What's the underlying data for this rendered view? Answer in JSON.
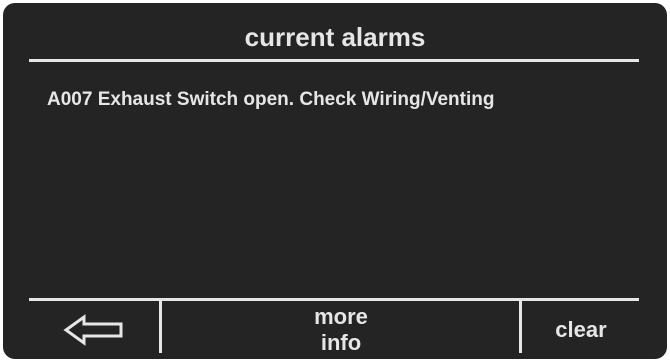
{
  "header": {
    "title": "current alarms"
  },
  "alarms": [
    {
      "text": "A007 Exhaust Switch open. Check Wiring/Venting"
    }
  ],
  "softkeys": {
    "back_icon": "left-arrow-outline",
    "more_info_line1": "more",
    "more_info_line2": "info",
    "clear_label": "clear"
  },
  "colors": {
    "background": "#242424",
    "foreground": "#e6e6e6",
    "frame": "#ffffff"
  }
}
